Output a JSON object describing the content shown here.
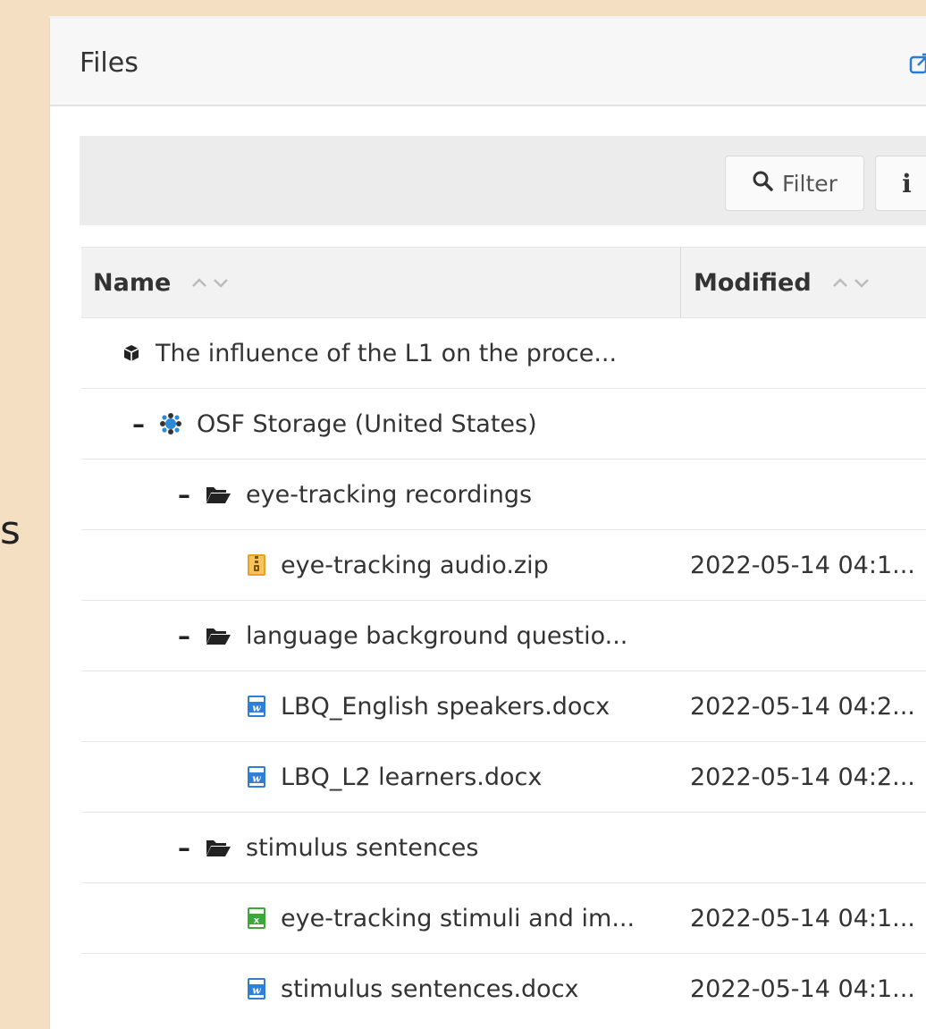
{
  "left_fragment": "s",
  "panel": {
    "title": "Files"
  },
  "toolbar": {
    "filter_label": "Filter",
    "info_label": "i"
  },
  "table": {
    "headers": {
      "name": "Name",
      "modified": "Modified"
    },
    "rows": [
      {
        "level": 0,
        "toggle": "",
        "icon": "cube-icon",
        "name": "The influence of the L1 on the proce...",
        "modified": ""
      },
      {
        "level": 1,
        "toggle": "–",
        "icon": "osf-storage-icon",
        "name": "OSF Storage (United States)",
        "modified": ""
      },
      {
        "level": 2,
        "toggle": "–",
        "icon": "folder-open-icon",
        "name": "eye-tracking recordings",
        "modified": ""
      },
      {
        "level": 3,
        "toggle": "",
        "icon": "zip-file-icon",
        "name": "eye-tracking audio.zip",
        "modified": "2022-05-14 04:1..."
      },
      {
        "level": 2,
        "toggle": "–",
        "icon": "folder-open-icon",
        "name": "language background questio...",
        "modified": ""
      },
      {
        "level": 3,
        "toggle": "",
        "icon": "word-file-icon",
        "name": "LBQ_English speakers.docx",
        "modified": "2022-05-14 04:2..."
      },
      {
        "level": 3,
        "toggle": "",
        "icon": "word-file-icon",
        "name": "LBQ_L2 learners.docx",
        "modified": "2022-05-14 04:2..."
      },
      {
        "level": 2,
        "toggle": "–",
        "icon": "folder-open-icon",
        "name": "stimulus sentences",
        "modified": ""
      },
      {
        "level": 3,
        "toggle": "",
        "icon": "excel-file-icon",
        "name": "eye-tracking stimuli and im...",
        "modified": "2022-05-14 04:1..."
      },
      {
        "level": 3,
        "toggle": "",
        "icon": "word-file-icon",
        "name": "stimulus sentences.docx",
        "modified": "2022-05-14 04:1..."
      }
    ]
  },
  "colors": {
    "page_background": "#f5dfc2",
    "zip_icon": "#e8a22b",
    "word_icon": "#2f7fd9",
    "excel_icon": "#3aa83a",
    "osf_icon": "#2c8ad8"
  }
}
